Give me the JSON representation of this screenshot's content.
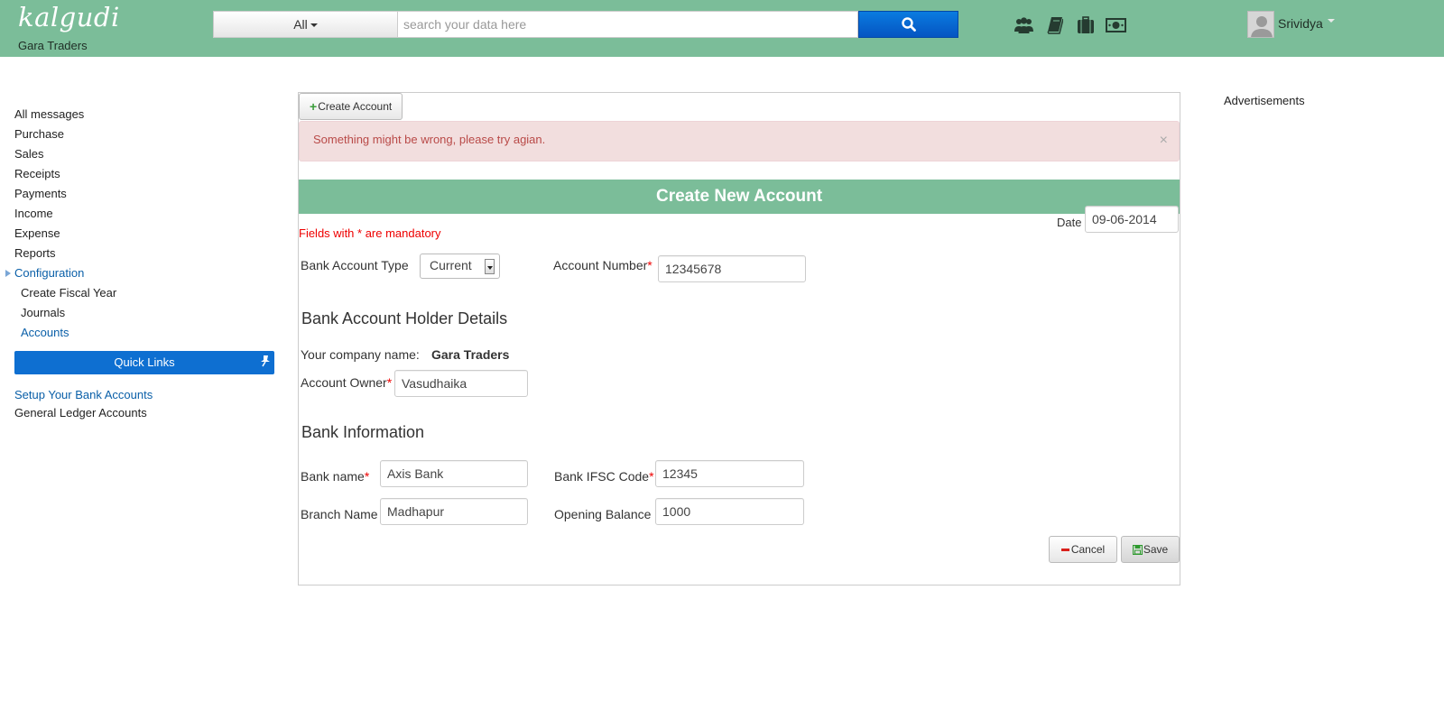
{
  "header": {
    "logo": "kalgudi",
    "company": "Gara Traders",
    "search_category": "All",
    "search_placeholder": "search your data here",
    "icons": [
      "users-icon",
      "book-icon",
      "briefcase-icon",
      "money-icon"
    ],
    "user_name": "Srividya"
  },
  "sidebar": {
    "items": [
      {
        "label": "All messages"
      },
      {
        "label": "Purchase"
      },
      {
        "label": "Sales"
      },
      {
        "label": "Receipts"
      },
      {
        "label": "Payments"
      },
      {
        "label": "Income"
      },
      {
        "label": "Expense"
      },
      {
        "label": "Reports"
      },
      {
        "label": "Configuration"
      }
    ],
    "config_sub": [
      {
        "label": "Create Fiscal Year"
      },
      {
        "label": "Journals"
      },
      {
        "label": "Accounts"
      }
    ],
    "quick_links_title": "Quick Links",
    "quick_links": [
      {
        "label": "Setup Your Bank Accounts"
      },
      {
        "label": "General Ledger Accounts"
      }
    ]
  },
  "main": {
    "create_account_label": "Create Account",
    "alert_text": "Something might be wrong, please try agian.",
    "alert_close": "×",
    "form_title": "Create New Account",
    "mandatory_note": "Fields with * are mandatory",
    "date_label": "Date",
    "date_value": "09-06-2014",
    "bank_account_type_label": "Bank Account Type",
    "bank_account_type_value": "Current",
    "account_number_label": "Account Number",
    "account_number_value": "12345678",
    "holder_section": "Bank Account Holder Details",
    "company_name_label": "Your company name:",
    "company_name_value": "Gara Traders",
    "account_owner_label": "Account Owner",
    "account_owner_value": "Vasudhaika",
    "bank_info_section": "Bank Information",
    "bank_name_label": "Bank name",
    "bank_name_value": "Axis Bank",
    "ifsc_label": "Bank IFSC Code",
    "ifsc_value": "12345",
    "branch_label": "Branch Name",
    "branch_value": "Madhapur",
    "opening_balance_label": "Opening Balance",
    "opening_balance_value": "1000",
    "required_mark": "*",
    "cancel_label": "Cancel",
    "save_label": "Save"
  },
  "ads_title": "Advertisements",
  "colors": {
    "header_green": "#7bbd99",
    "primary_blue": "#0e6fd1",
    "alert_bg": "#f2dede",
    "alert_text": "#b94a48",
    "required_red": "#ee0000"
  }
}
